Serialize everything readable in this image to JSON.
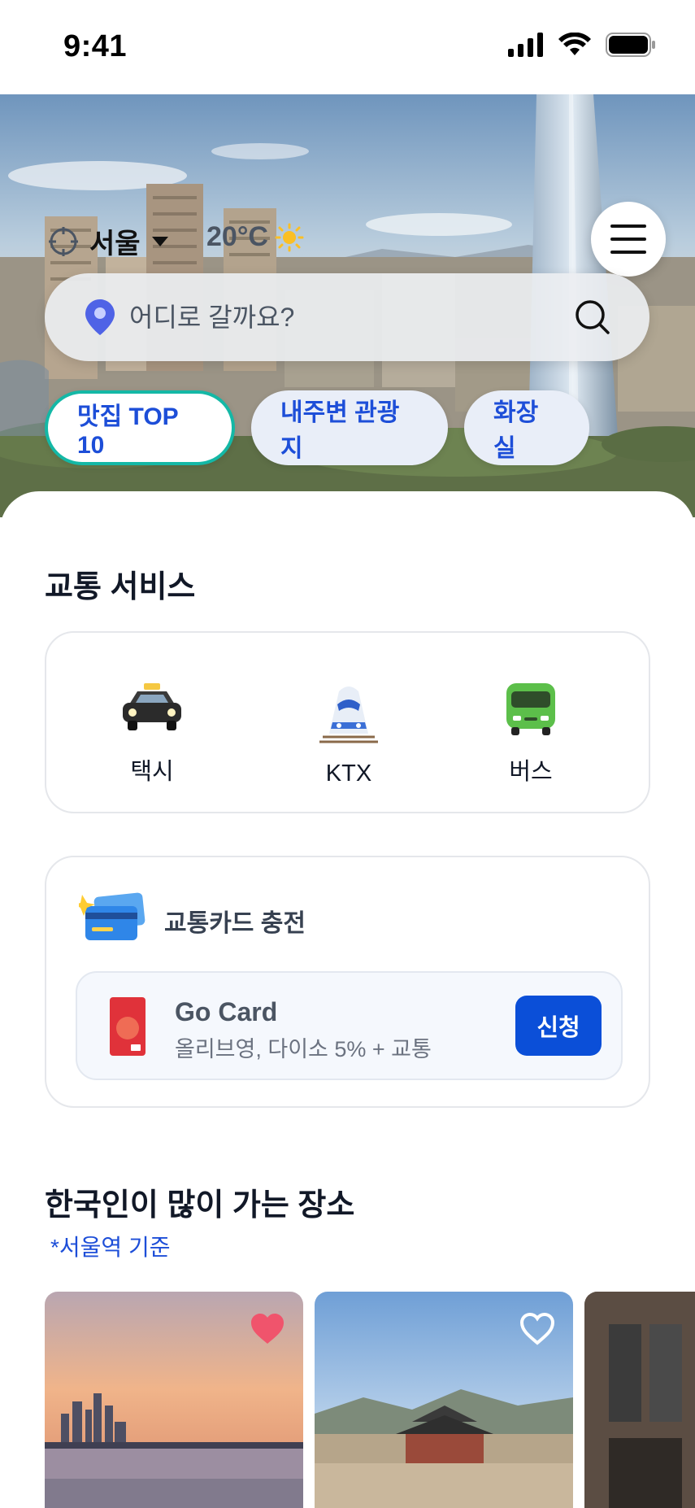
{
  "status_bar": {
    "time": "9:41"
  },
  "header": {
    "location": "서울",
    "temperature": "20°C",
    "weather_icon": "sun-icon",
    "menu_icon": "hamburger-menu-icon"
  },
  "search": {
    "placeholder": "어디로 갈까요?",
    "value": ""
  },
  "chips": [
    {
      "label": "맛집 TOP 10",
      "active": true
    },
    {
      "label": "내주변 관광지",
      "active": false
    },
    {
      "label": "화장실",
      "active": false
    }
  ],
  "transport": {
    "title": "교통 서비스",
    "items": [
      {
        "label": "택시",
        "icon": "taxi-icon"
      },
      {
        "label": "KTX",
        "icon": "ktx-train-icon"
      },
      {
        "label": "버스",
        "icon": "bus-icon"
      }
    ]
  },
  "card_charge": {
    "title": "교통카드 충전",
    "card_name": "Go Card",
    "card_desc": "올리브영, 다이소 5% + 교통",
    "apply_label": "신청"
  },
  "popular": {
    "title": "한국인이 많이 가는 장소",
    "note": "*서울역 기준",
    "places": [
      {
        "image": "han-river-sunset",
        "favorited": true
      },
      {
        "image": "gyeongbokgung-palace",
        "favorited": false
      },
      {
        "image": "street-cafe",
        "favorited": false
      }
    ]
  },
  "colors": {
    "accent": "#0b4fd8",
    "chip_text": "#1d4ed8",
    "active_chip_border": "#14b8a6",
    "heart_active": "#f0546c"
  }
}
